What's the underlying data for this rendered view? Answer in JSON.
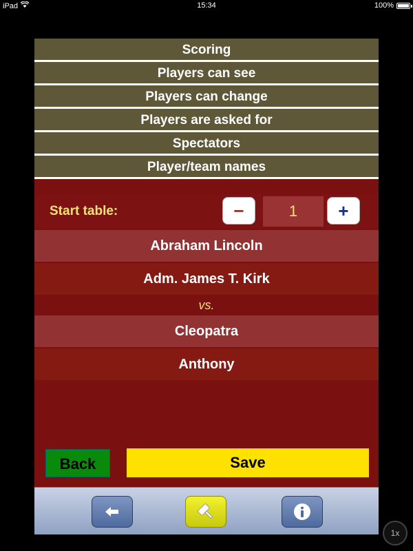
{
  "status_bar": {
    "device": "iPad",
    "time": "15:34",
    "battery": "100%",
    "battery_level": 1.0
  },
  "menu": {
    "items": [
      {
        "label": "Scoring"
      },
      {
        "label": "Players can see"
      },
      {
        "label": "Players can change"
      },
      {
        "label": "Players are asked for"
      },
      {
        "label": "Spectators"
      },
      {
        "label": "Player/team names"
      }
    ]
  },
  "config": {
    "start_table_label": "Start table:",
    "start_table_value": "1",
    "minus_label": "−",
    "plus_label": "+",
    "players": [
      {
        "name": "Abraham Lincoln"
      },
      {
        "name": "Adm. James T. Kirk"
      },
      {
        "name": "Cleopatra"
      },
      {
        "name": "Anthony"
      }
    ],
    "vs_label": "vs."
  },
  "actions": {
    "back_label": "Back",
    "save_label": "Save"
  },
  "toolbar": {
    "buttons": [
      {
        "icon": "arrow-left-icon"
      },
      {
        "icon": "gavel-icon"
      },
      {
        "icon": "info-icon"
      }
    ]
  },
  "zoom": {
    "label": "1x"
  },
  "colors": {
    "menu_bg": "#5e5839",
    "panel_bg": "#7a1010",
    "accent_yellow": "#f2e27a",
    "save_bg": "#ffe100",
    "back_bg": "#0a8a0a"
  }
}
